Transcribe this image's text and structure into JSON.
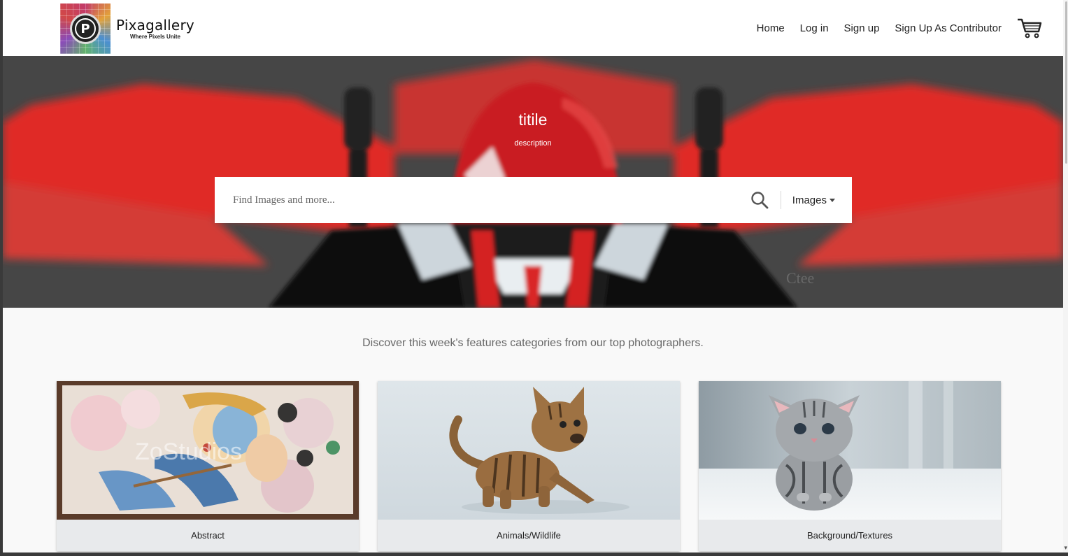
{
  "brand": {
    "name": "Pixagallery",
    "tagline": "Where Pixels Unite",
    "logo_letter": "P"
  },
  "nav": {
    "links": [
      "Home",
      "Log in",
      "Sign up",
      "Sign Up As Contributor"
    ],
    "cart_icon": "shopping-cart-icon"
  },
  "hero": {
    "title": "titile",
    "description": "description"
  },
  "search": {
    "placeholder": "Find Images and more...",
    "type_selected": "Images",
    "icon": "search-icon"
  },
  "discover": {
    "heading": "Discover this week's features categories from our top photographers."
  },
  "categories": [
    {
      "label": "Abstract"
    },
    {
      "label": "Animals/Wildlife"
    },
    {
      "label": "Background/Textures"
    }
  ],
  "colors": {
    "header_bg": "#ffffff",
    "hero_red": "#e8292a",
    "page_bg": "#f9f9f9",
    "card_label_bg": "#e8eaec"
  }
}
